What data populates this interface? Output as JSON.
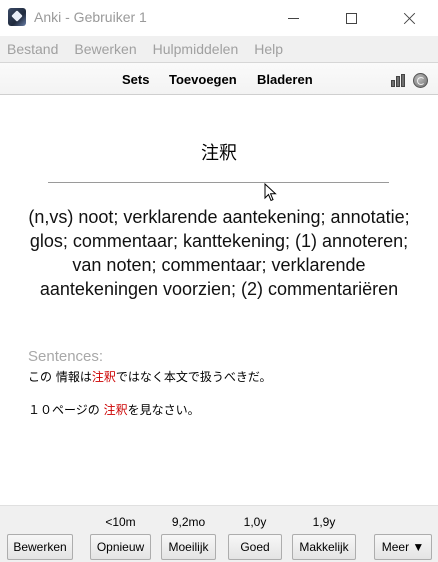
{
  "window": {
    "title": "Anki - Gebruiker 1"
  },
  "menu": [
    "Bestand",
    "Bewerken",
    "Hulpmiddelen",
    "Help"
  ],
  "toolbar": {
    "sets": "Sets",
    "add": "Toevoegen",
    "browse": "Bladeren"
  },
  "card": {
    "front": "注釈",
    "back": "(n,vs) noot; verklarende aantekening; annotatie; glos; commentaar; kanttekening; (1) annoteren; van noten; commentaar; verklarende aantekeningen voorzien; (2) commentariëren",
    "sentences_label": "Sentences:",
    "sentences": [
      {
        "before": "この 情報は",
        "highlight": "注釈",
        "after": "ではなく本文で扱うべきだ。"
      },
      {
        "before": "１０ページの ",
        "highlight": "注釈",
        "after": "を見なさい。"
      }
    ],
    "highlight_color": "#cc0000"
  },
  "answer_bar": {
    "edit": "Bewerken",
    "buttons": [
      {
        "label": "Opnieuw",
        "interval": "<10m"
      },
      {
        "label": "Moeilijk",
        "interval": "9,2mo"
      },
      {
        "label": "Goed",
        "interval": "1,0y"
      },
      {
        "label": "Makkelijk",
        "interval": "1,9y"
      }
    ],
    "more": "Meer ▼"
  }
}
